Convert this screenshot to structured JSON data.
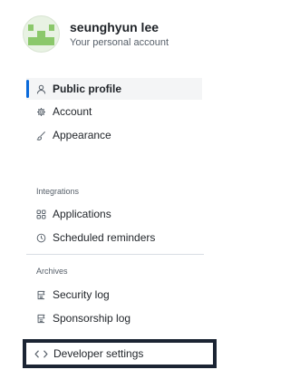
{
  "profile": {
    "name": "seunghyun lee",
    "subtitle": "Your personal account"
  },
  "nav": {
    "public_profile": "Public profile",
    "account": "Account",
    "appearance": "Appearance",
    "integrations_heading": "Integrations",
    "applications": "Applications",
    "scheduled_reminders": "Scheduled reminders",
    "archives_heading": "Archives",
    "security_log": "Security log",
    "sponsorship_log": "Sponsorship log",
    "developer_settings": "Developer settings"
  },
  "icons": {
    "public_profile": "person-icon",
    "account": "gear-icon",
    "appearance": "paintbrush-icon",
    "applications": "apps-grid-icon",
    "scheduled_reminders": "clock-icon",
    "security_log": "log-icon",
    "sponsorship_log": "log-icon",
    "developer_settings": "code-icon"
  },
  "colors": {
    "active_indicator": "#0969da",
    "avatar_accent": "#8bc86b",
    "highlight_border": "#1b2433"
  }
}
